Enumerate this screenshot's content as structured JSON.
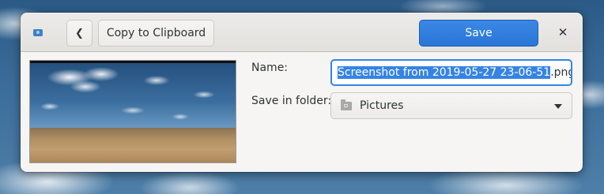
{
  "header": {
    "app_icon": "screenshot-app-icon",
    "back_icon": "chevron-left-icon",
    "back_glyph": "❮",
    "copy_label": "Copy to Clipboard",
    "save_label": "Save",
    "close_icon": "close-icon",
    "close_glyph": "✕"
  },
  "preview": {
    "kind": "screenshot-thumbnail"
  },
  "form": {
    "name_label": "Name:",
    "name_value_selected": "Screenshot from 2019-05-27 23-06-51",
    "name_value_rest": ".png",
    "folder_label": "Save in folder:",
    "folder_icon": "folder-icon",
    "folder_value": "Pictures",
    "dropdown_icon": "chevron-down-icon"
  },
  "colors": {
    "accent": "#3584e4",
    "dialog_bg": "#f6f5f4",
    "text": "#2e3436"
  }
}
